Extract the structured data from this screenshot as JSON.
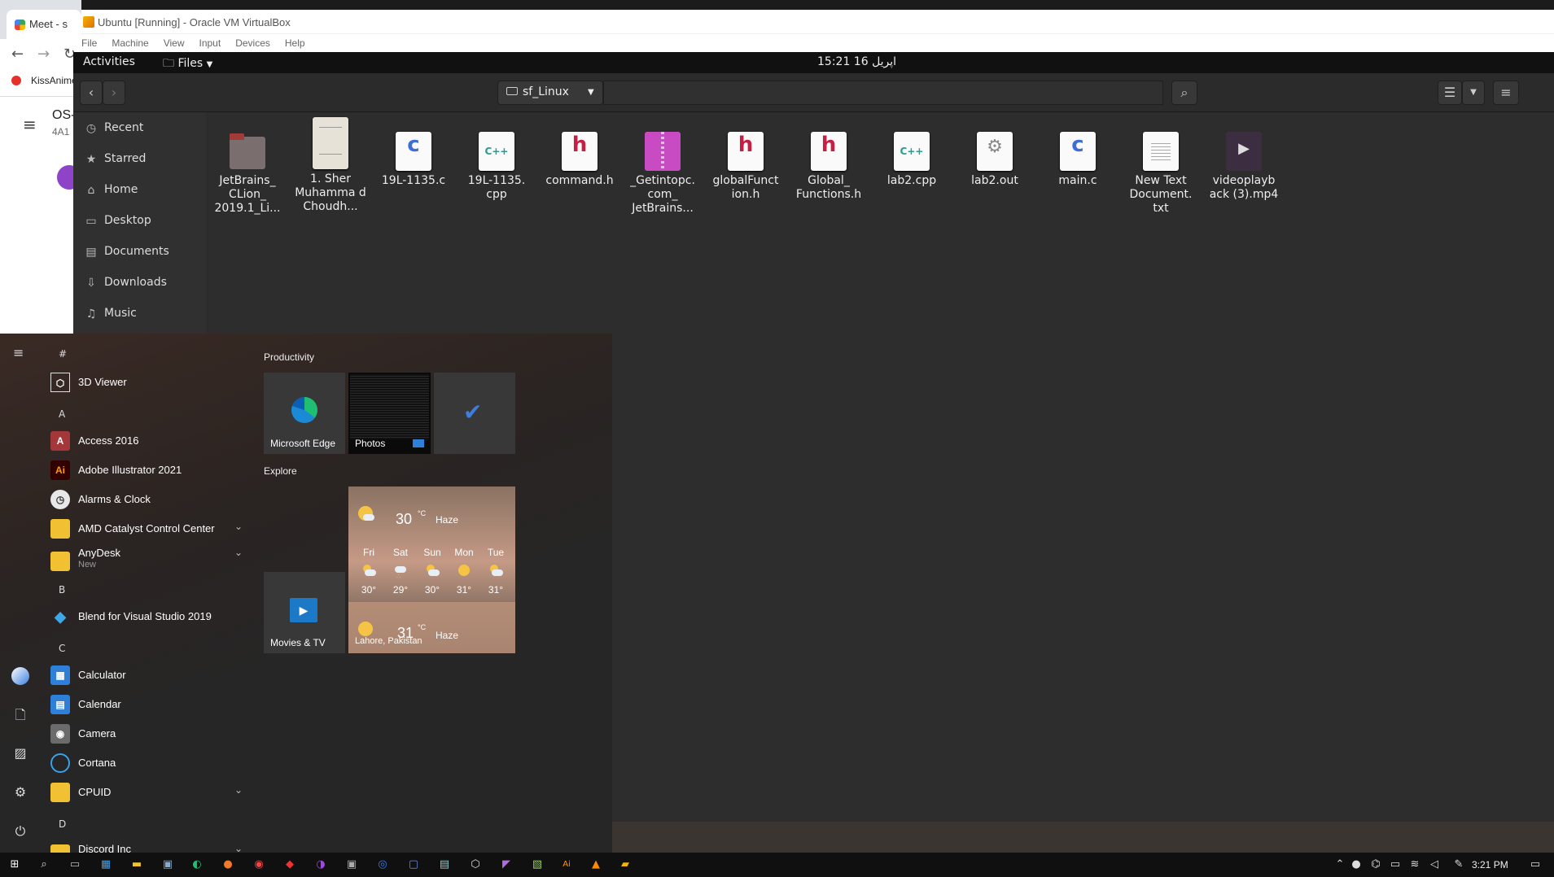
{
  "chrome": {
    "tab_title": "Meet - s",
    "bookmark": "KissAnime",
    "page_title": "OS-",
    "page_subtitle": "4A1"
  },
  "vm": {
    "title": "Ubuntu [Running] - Oracle VM VirtualBox",
    "menu": [
      "File",
      "Machine",
      "View",
      "Input",
      "Devices",
      "Help"
    ]
  },
  "gnome": {
    "activities": "Activities",
    "app_menu": "Files",
    "clock": "15:21  16 اپریل"
  },
  "files": {
    "location": "sf_Linux",
    "sidebar": [
      "Recent",
      "Starred",
      "Home",
      "Desktop",
      "Documents",
      "Downloads",
      "Music"
    ],
    "items": [
      {
        "name": "JetBrains_ CLion_ 2019.1_Li...",
        "icon": "folder-icon"
      },
      {
        "name": "1. Sher Muhamma d Choudh...",
        "icon": "pdf-thumbnail"
      },
      {
        "name": "19L-1135.c",
        "icon": "c-source-icon"
      },
      {
        "name": "19L-1135. cpp",
        "icon": "cpp-source-icon"
      },
      {
        "name": "command.h",
        "icon": "header-icon"
      },
      {
        "name": "_Getintopc. com_ JetBrains...",
        "icon": "archive-icon"
      },
      {
        "name": "globalFunct ion.h",
        "icon": "header-icon"
      },
      {
        "name": "Global_ Functions.h",
        "icon": "header-icon"
      },
      {
        "name": "lab2.cpp",
        "icon": "cpp-source-icon"
      },
      {
        "name": "lab2.out",
        "icon": "executable-icon"
      },
      {
        "name": "main.c",
        "icon": "c-source-icon"
      },
      {
        "name": "New Text Document. txt",
        "icon": "text-icon"
      },
      {
        "name": "videoplayb ack (3).mp4",
        "icon": "video-icon"
      }
    ]
  },
  "start_menu": {
    "apps": [
      {
        "type": "header",
        "label": "#"
      },
      {
        "type": "app",
        "label": "3D Viewer",
        "icon": "cube-icon"
      },
      {
        "type": "header",
        "label": "A"
      },
      {
        "type": "app",
        "label": "Access 2016",
        "icon": "access-icon"
      },
      {
        "type": "app",
        "label": "Adobe Illustrator 2021",
        "icon": "illustrator-icon"
      },
      {
        "type": "app",
        "label": "Alarms & Clock",
        "icon": "clock-icon"
      },
      {
        "type": "folder",
        "label": "AMD Catalyst Control Center",
        "icon": "folder-icon"
      },
      {
        "type": "folder",
        "label": "AnyDesk",
        "sub": "New",
        "icon": "folder-icon"
      },
      {
        "type": "header",
        "label": "B"
      },
      {
        "type": "app",
        "label": "Blend for Visual Studio 2019",
        "icon": "blend-icon"
      },
      {
        "type": "header",
        "label": "C"
      },
      {
        "type": "app",
        "label": "Calculator",
        "icon": "calculator-icon"
      },
      {
        "type": "app",
        "label": "Calendar",
        "icon": "calendar-icon"
      },
      {
        "type": "app",
        "label": "Camera",
        "icon": "camera-icon"
      },
      {
        "type": "app",
        "label": "Cortana",
        "icon": "cortana-icon"
      },
      {
        "type": "folder",
        "label": "CPUID",
        "icon": "folder-icon"
      },
      {
        "type": "header",
        "label": "D"
      },
      {
        "type": "folder",
        "label": "Discord Inc",
        "icon": "folder-icon"
      }
    ],
    "groups": {
      "productivity": "Productivity",
      "explore": "Explore"
    },
    "tiles": {
      "edge": "Microsoft Edge",
      "photos": "Photos",
      "movies": "Movies & TV"
    },
    "weather": {
      "temp": "30",
      "unit": "°C",
      "cond": "Haze",
      "days": [
        {
          "d": "Fri",
          "t": "30°",
          "icon": "partly-cloudy"
        },
        {
          "d": "Sat",
          "t": "29°",
          "icon": "rain"
        },
        {
          "d": "Sun",
          "t": "30°",
          "icon": "partly-cloudy"
        },
        {
          "d": "Mon",
          "t": "31°",
          "icon": "sunny"
        },
        {
          "d": "Tue",
          "t": "31°",
          "icon": "partly-cloudy"
        }
      ],
      "temp2": "31",
      "unit2": "°C",
      "cond2": "Haze",
      "location": "Lahore, Pakistan"
    }
  },
  "taskbar": {
    "time": "3:21 PM"
  }
}
